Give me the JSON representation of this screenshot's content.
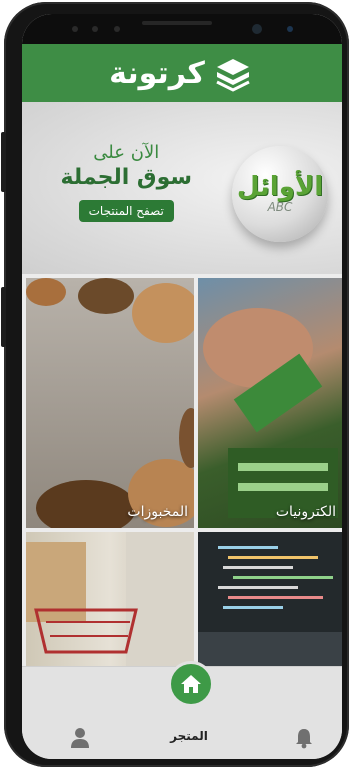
{
  "app": {
    "brand_name": "كرتونة"
  },
  "banner": {
    "line1": "الآن على",
    "line2": "سوق الجملة",
    "button_label": "تصفح المنتجات",
    "brand_title": "الأوائل",
    "brand_sub": "ABC"
  },
  "categories": [
    {
      "label": "الكترونيات"
    },
    {
      "label": "المخبوزات"
    },
    {
      "label": ""
    },
    {
      "label": ""
    }
  ],
  "bottom_nav": {
    "home_label": "المتجر",
    "items": [
      "bell-icon",
      "home-icon",
      "user-icon"
    ]
  },
  "colors": {
    "primary": "#3e8d45",
    "accent": "#3e9a47"
  }
}
